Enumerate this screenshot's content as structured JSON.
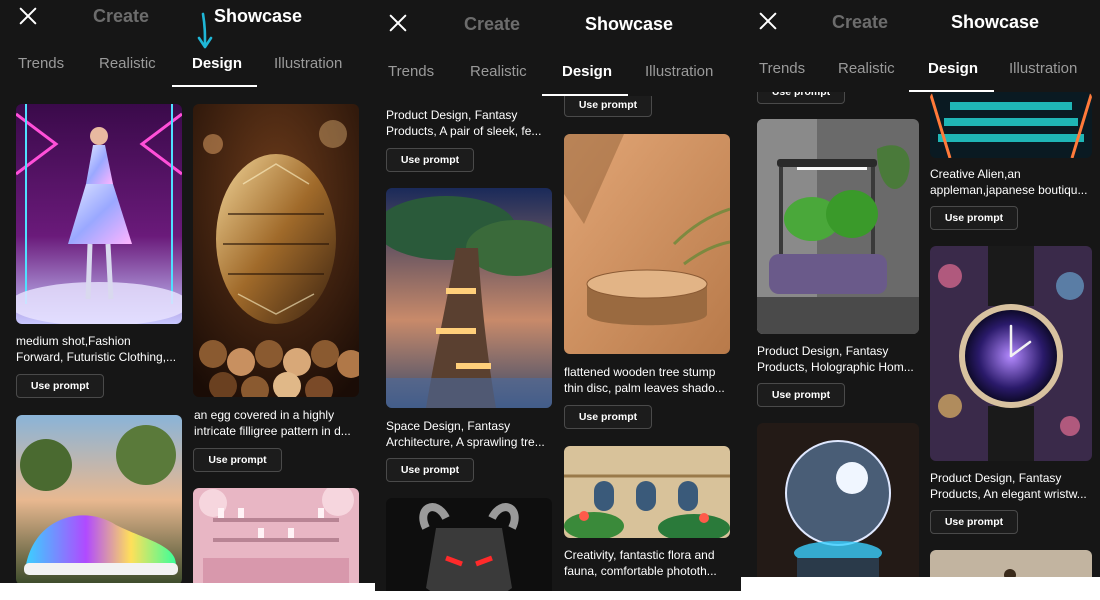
{
  "header": {
    "create_label": "Create",
    "showcase_label": "Showcase"
  },
  "tabs": [
    "Trends",
    "Realistic",
    "Design",
    "Illustration"
  ],
  "active_tab": "Design",
  "button_label": "Use prompt",
  "colors": {
    "background": "#161616",
    "accent_arrow": "#1fb6d6",
    "active_text": "#ffffff",
    "inactive_text": "#9a9a9a"
  },
  "panels": [
    {
      "cards": [
        {
          "caption_1": "medium shot,Fashion",
          "caption_2": "Forward, Futuristic Clothing,..."
        },
        {
          "caption_1": "an egg covered in a highly",
          "caption_2": "intricate filligree pattern in d..."
        },
        {
          "caption_1": "",
          "caption_2": ""
        },
        {
          "caption_1": "",
          "caption_2": ""
        }
      ]
    },
    {
      "cards": [
        {
          "caption_1": "Product Design, Fantasy",
          "caption_2": "Products, A pair of sleek, fe..."
        },
        {
          "caption_1": "flattened wooden tree stump",
          "caption_2": "thin disc, palm leaves shado..."
        },
        {
          "caption_1": "Space Design, Fantasy",
          "caption_2": "Architecture, A sprawling tre..."
        },
        {
          "caption_1": "Creativity, fantastic flora and",
          "caption_2": "fauna, comfortable phototh..."
        }
      ]
    },
    {
      "cards": [
        {
          "caption_1": "Creative Alien,an",
          "caption_2": "appleman,japanese boutiqu..."
        },
        {
          "caption_1": "Product Design, Fantasy",
          "caption_2": "Products, Holographic Hom..."
        },
        {
          "caption_1": "Product Design, Fantasy",
          "caption_2": "Products, An elegant wristw..."
        }
      ]
    }
  ]
}
